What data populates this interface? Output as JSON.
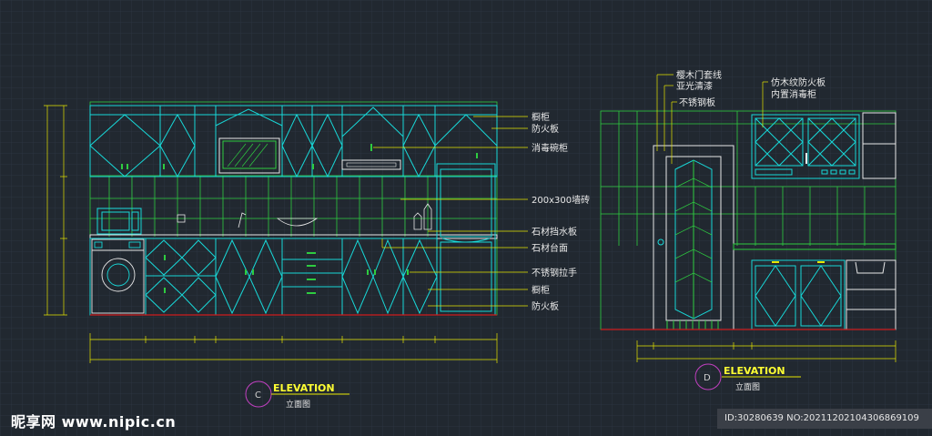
{
  "elevation_c": {
    "labels": [
      "橱柜",
      "防火板",
      "消毒碗柜",
      "200x300墙砖",
      "石材挡水板",
      "石材台面",
      "不锈钢拉手",
      "橱柜",
      "防火板"
    ],
    "title": "ELEVATION",
    "subtitle": "立面图",
    "marker": "C"
  },
  "elevation_d": {
    "labels": [
      "樱木门套线",
      "亚光清漆",
      "不锈钢板",
      "仿木纹防火板",
      "内置消毒柜"
    ],
    "title": "ELEVATION",
    "subtitle": "立面图",
    "marker": "D"
  },
  "watermark": "昵享网 www.nipic.cn",
  "image_id": "ID:30280639 NO:20211202104306869109",
  "colors": {
    "background": "#212830",
    "cyan": "#18d8d8",
    "green": "#2ecc40",
    "yellow": "#e6e600",
    "red": "#d01c1c",
    "magenta": "#c040c0"
  }
}
